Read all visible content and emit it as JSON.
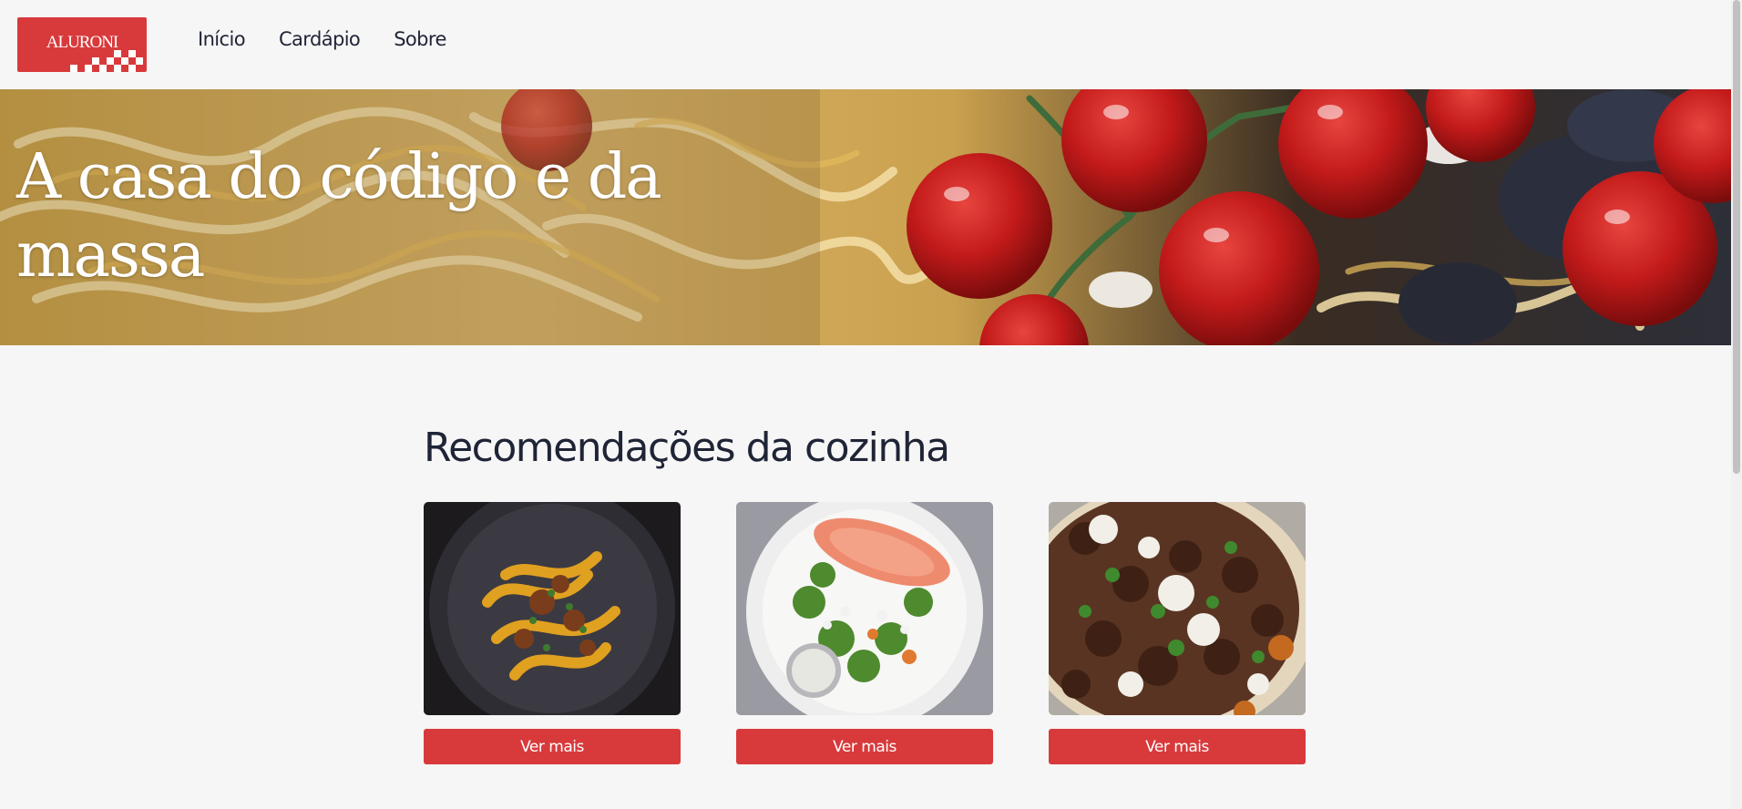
{
  "brand": {
    "logo_text": "ALURONI",
    "accent_color": "#d83a3c"
  },
  "nav": {
    "items": [
      {
        "label": "Início"
      },
      {
        "label": "Cardápio"
      },
      {
        "label": "Sobre"
      }
    ]
  },
  "hero": {
    "title": "A casa do código e da massa"
  },
  "recommendations": {
    "title": "Recomendações da cozinha",
    "cards": [
      {
        "image": "tagliatelle-bolognese-image",
        "button_label": "Ver mais"
      },
      {
        "image": "salmon-salad-image",
        "button_label": "Ver mais"
      },
      {
        "image": "meatballs-dish-image",
        "button_label": "Ver mais"
      }
    ]
  }
}
